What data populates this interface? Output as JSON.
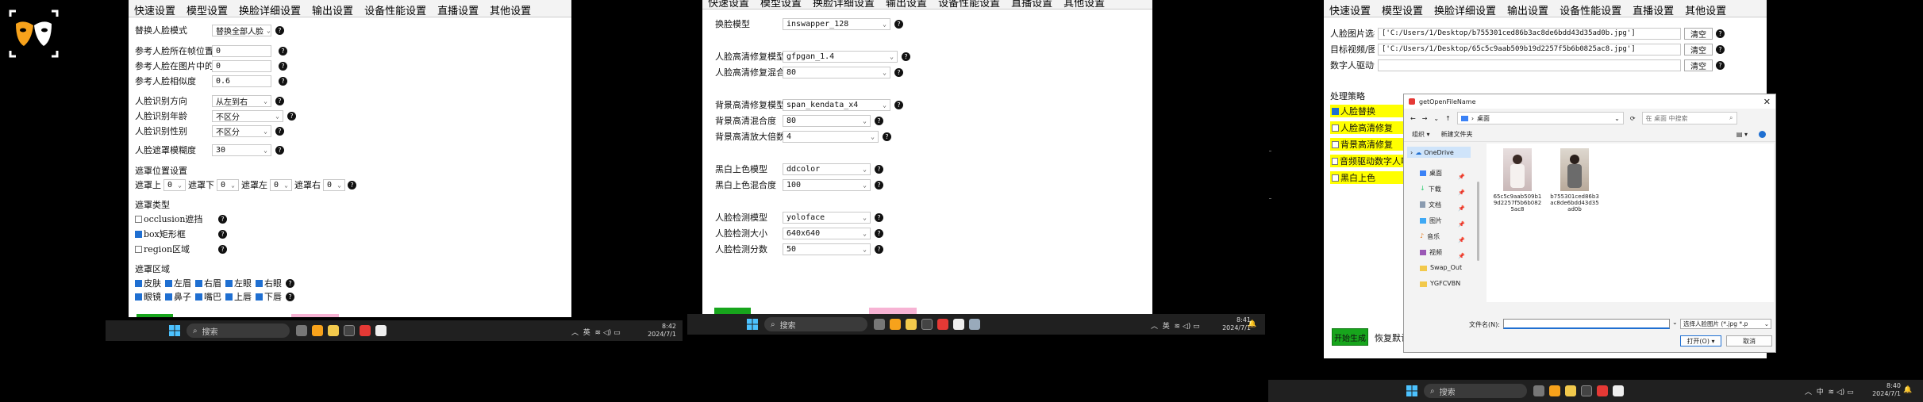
{
  "app": {
    "name": "FaceFusion",
    "accent": "#f7a21b"
  },
  "tabs": [
    "快速设置",
    "模型设置",
    "换脸详细设置",
    "输出设置",
    "设备性能设置",
    "直播设置",
    "其他设置"
  ],
  "panel1": {
    "swap_mode": {
      "label": "替换人脸模式",
      "value": "替换全部人脸"
    },
    "ref_frame": {
      "label": "参考人脸所在帧位置",
      "value": "0"
    },
    "ref_index": {
      "label": "参考人脸在图片中的",
      "value": "0"
    },
    "ref_similarity": {
      "label": "参考人脸相似度",
      "value": "0.6"
    },
    "face_direction": {
      "label": "人脸识别方向",
      "value": "从左到右"
    },
    "face_age": {
      "label": "人脸识别年龄",
      "value": "不区分"
    },
    "face_gender": {
      "label": "人脸识别性别",
      "value": "不区分"
    },
    "mask_blur": {
      "label": "人脸遮罩模糊度",
      "value": "30"
    },
    "mask_pos_title": "遮罩位置设置",
    "mask_pos": [
      {
        "label": "遮罩上",
        "value": "0"
      },
      {
        "label": "遮罩下",
        "value": "0"
      },
      {
        "label": "遮罩左",
        "value": "0"
      },
      {
        "label": "遮罩右",
        "value": "0"
      }
    ],
    "mask_type_title": "遮罩类型",
    "mask_types": [
      {
        "label": "occlusion遮挡",
        "checked": false
      },
      {
        "label": "box矩形框",
        "checked": true
      },
      {
        "label": "region区域",
        "checked": false
      }
    ],
    "mask_region_title": "遮罩区域",
    "regions_row1": [
      "皮肤",
      "左眉",
      "右眉",
      "左眼",
      "右眼"
    ],
    "regions_row2": [
      "眼镜",
      "鼻子",
      "嘴巴",
      "上唇",
      "下唇"
    ]
  },
  "panel2": {
    "fields": [
      {
        "label": "换脸模型",
        "value": "inswapper_128"
      },
      {
        "label": "人脸高清修复模型",
        "value": "gfpgan_1.4"
      },
      {
        "label": "人脸高清修复混合度",
        "value": "80"
      },
      {
        "label": "背景高清修复模型",
        "value": "span_kendata_x4"
      },
      {
        "label": "背景高清混合度",
        "value": "80"
      },
      {
        "label": "背景高清放大倍数",
        "value": "4"
      },
      {
        "label": "黑白上色模型",
        "value": "ddcolor"
      },
      {
        "label": "黑白上色混合度",
        "value": "100"
      },
      {
        "label": "人脸检测模型",
        "value": "yoloface"
      },
      {
        "label": "人脸检测大小",
        "value": "640x640"
      },
      {
        "label": "人脸检测分数",
        "value": "50"
      }
    ]
  },
  "panel3": {
    "face_image": {
      "label": "人脸图片选择",
      "value": "['C:/Users/1/Desktop/b755301ced86b3ac8de6bdd43d35ad0b.jpg']",
      "clear": "清空"
    },
    "target_media": {
      "label": "目标视频/图片选择",
      "value": "['C:/Users/1/Desktop/65c5c9aab509b19d2257f5b6b0825ac8.jpg']",
      "clear": "清空"
    },
    "audio_drive": {
      "label": "数字人驱动音频选择",
      "value": "",
      "clear": "清空"
    },
    "strategy_title": "处理策略",
    "strategies": [
      {
        "label": "人脸替换",
        "checked": true
      },
      {
        "label": "人脸高清修复",
        "checked": false
      },
      {
        "label": "背景高清修复",
        "checked": false
      },
      {
        "label": "音频驱动数字人嘴",
        "checked": false
      },
      {
        "label": "黑白上色",
        "checked": false
      }
    ],
    "start_button": "开始生成",
    "restore_button": "恢复默认"
  },
  "dialog": {
    "title": "getOpenFileName",
    "path": "桌面",
    "search_placeholder": "在 桌面 中搜索",
    "organize": "组织 ▾",
    "new_folder": "新建文件夹",
    "nav": [
      {
        "label": "OneDrive",
        "icon": "cloud-icon"
      },
      {
        "label": "桌面",
        "icon": "desktop-icon"
      },
      {
        "label": "下载",
        "icon": "download-icon"
      },
      {
        "label": "文档",
        "icon": "document-icon"
      },
      {
        "label": "图片",
        "icon": "picture-icon"
      },
      {
        "label": "音乐",
        "icon": "music-icon"
      },
      {
        "label": "视频",
        "icon": "video-icon"
      },
      {
        "label": "Swap_Out",
        "icon": "folder-icon"
      },
      {
        "label": "YGFCVBN",
        "icon": "folder-icon"
      }
    ],
    "files": [
      {
        "name": "65c5c9aab509b19d2257f5b6b0825ac8"
      },
      {
        "name": "b755301ced86b3ac8de6bdd43d35ad0b"
      }
    ],
    "filename_label": "文件名(N):",
    "filter": "选择人脸图片 (*.jpg *.p",
    "open": "打开(O)",
    "cancel": "取消"
  },
  "taskbar": {
    "search": "搜索",
    "ime": "英",
    "time1": "8:42",
    "date1": "2024/7/1",
    "time2": "8:41",
    "date2": "2024/7/1",
    "time3": "8:40",
    "date3": "2024/7/1",
    "tray3_ime": "中"
  }
}
